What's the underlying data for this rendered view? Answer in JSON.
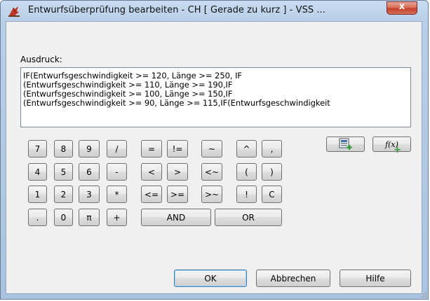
{
  "window": {
    "title": "Entwurfsüberprüfung bearbeiten - CH [ Gerade zu kurz ] - VSS ...",
    "close_label": "x",
    "accent": "#a9c3e0"
  },
  "expression": {
    "label": "Ausdruck:",
    "lines": [
      "IF(Entwurfsgeschwindigkeit  >= 120, Länge  >= 250, IF",
      "(Entwurfsgeschwindigkeit  >= 110, Länge  >= 190,IF",
      "(Entwurfsgeschwindigkeit  >= 100, Länge  >= 150,IF",
      "(Entwurfsgeschwindigkeit  >= 90, Länge  >= 115,IF(Entwurfsgeschwindigkeit"
    ]
  },
  "keypad": {
    "numeric": [
      [
        "7",
        "8",
        "9",
        "/"
      ],
      [
        "4",
        "5",
        "6",
        "-"
      ],
      [
        "1",
        "2",
        "3",
        "*"
      ],
      [
        ".",
        "0",
        "π",
        "+"
      ]
    ],
    "compare": [
      [
        "=",
        "!="
      ],
      [
        "<",
        ">"
      ],
      [
        "<=",
        ">="
      ]
    ],
    "tilde": [
      "~",
      "<~",
      ">~"
    ],
    "misc": [
      [
        "^",
        ","
      ],
      [
        "(",
        ")"
      ],
      [
        "!",
        "C"
      ]
    ],
    "and_label": "AND",
    "or_label": "OR"
  },
  "tools": {
    "insert_property_icon": "insert-property-icon",
    "insert_function_label": "f(x)"
  },
  "footer": {
    "ok_label": "OK",
    "cancel_label": "Abbrechen",
    "help_label": "Hilfe"
  }
}
